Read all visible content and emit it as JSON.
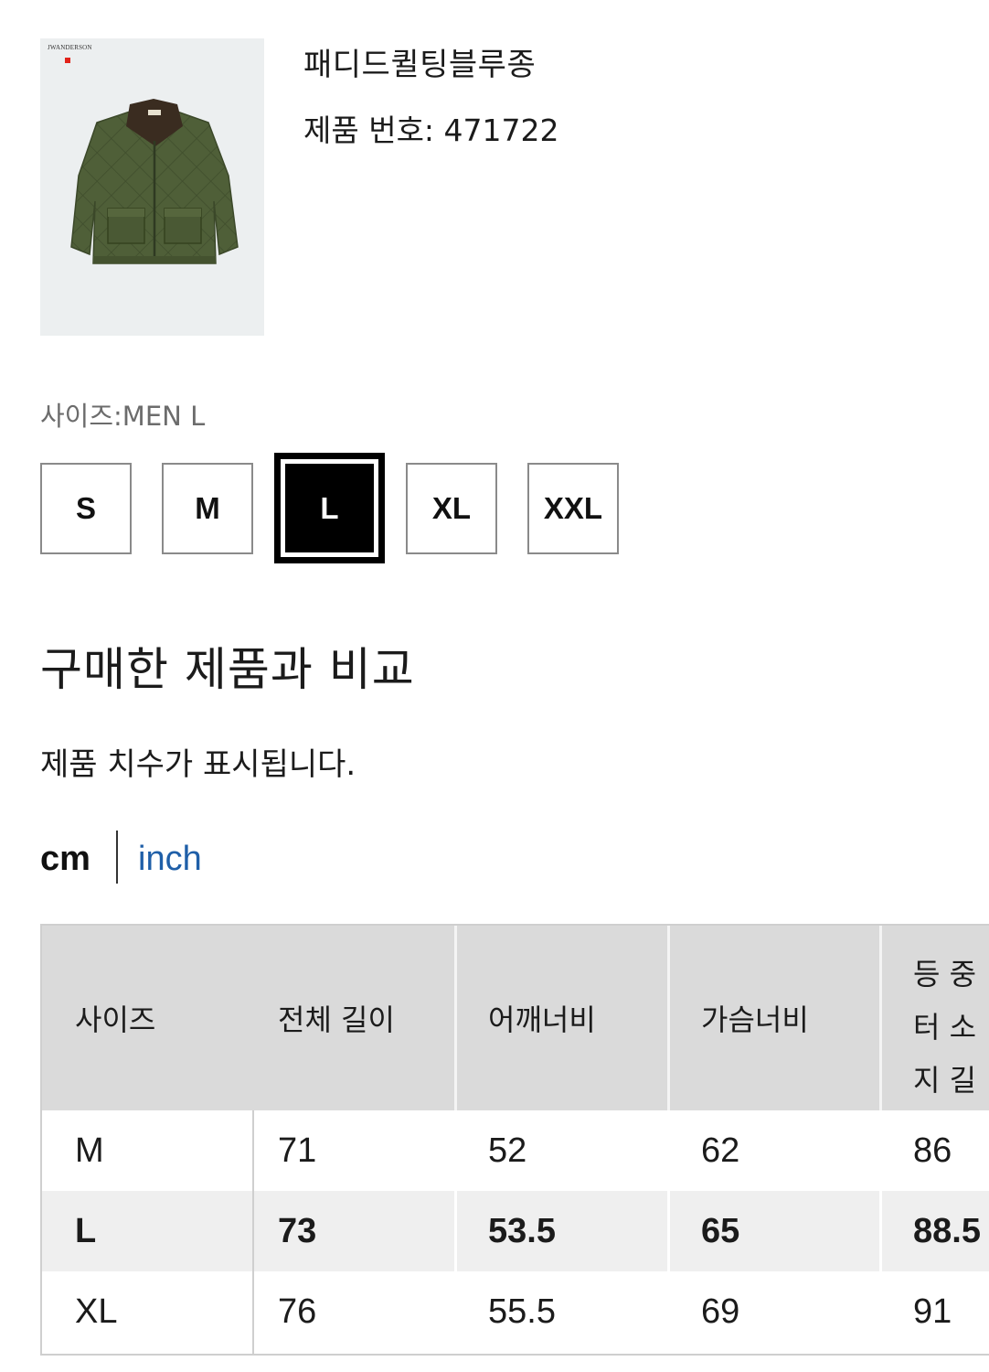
{
  "product": {
    "brand_logo_text": "JWANDERSON",
    "name": "패디드퀼팅블루종",
    "number": "제품 번호: 471722"
  },
  "size_selector": {
    "label": "사이즈:MEN L",
    "options": [
      "S",
      "M",
      "L",
      "XL",
      "XXL"
    ],
    "selected": "L"
  },
  "compare": {
    "title": "구매한 제품과 비교",
    "description": "제품 치수가 표시됩니다."
  },
  "units": {
    "cm": "cm",
    "inch": "inch",
    "active": "cm",
    "inch_color": "#1f5fa8"
  },
  "table": {
    "headers": [
      "사이즈",
      "전체 길이",
      "어깨너비",
      "가슴너비",
      "등 중심부터 소매까지 길이"
    ],
    "header_visible_lines": [
      "등 중",
      "터 소",
      "지 길"
    ],
    "rows": [
      [
        "M",
        "71",
        "52",
        "62",
        "86"
      ],
      [
        "L",
        "73",
        "53.5",
        "65",
        "88.5"
      ],
      [
        "XL",
        "76",
        "55.5",
        "69",
        "91"
      ]
    ],
    "highlighted_row": "L"
  },
  "colors": {
    "header_bg": "#dadada",
    "highlight_row_bg": "#efefef",
    "jacket_green": "#4f5f38",
    "collar_brown": "#3a2c20"
  }
}
